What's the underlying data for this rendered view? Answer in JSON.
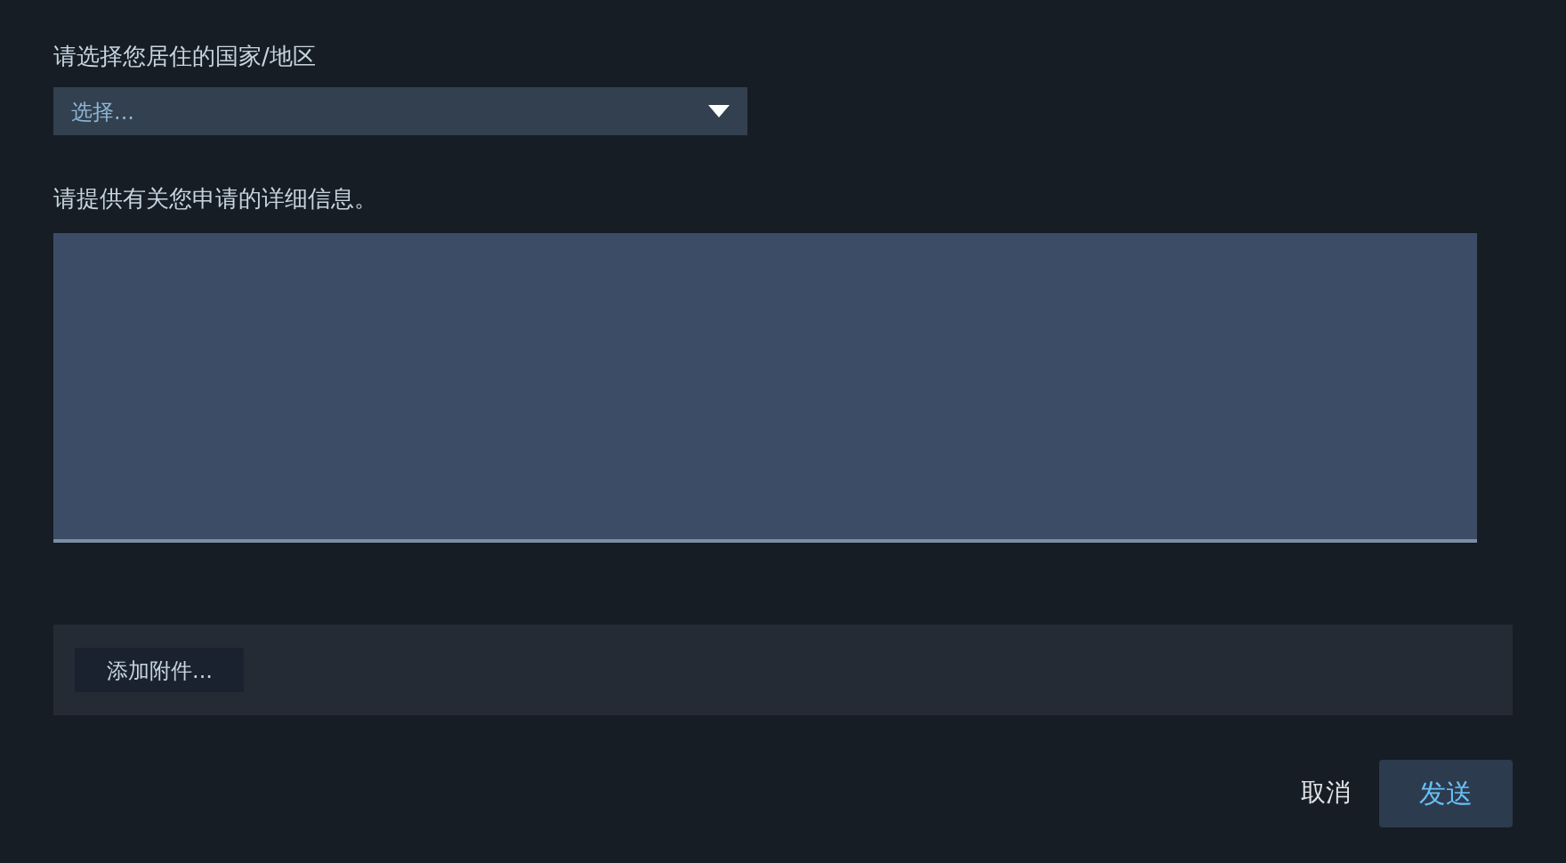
{
  "country_field": {
    "label": "请选择您居住的国家/地区",
    "dropdown": {
      "value": "选择..."
    }
  },
  "details_field": {
    "label": "请提供有关您申请的详细信息。"
  },
  "attachments": {
    "button": "添加附件..."
  },
  "actions": {
    "cancel": "取消",
    "send": "发送"
  }
}
